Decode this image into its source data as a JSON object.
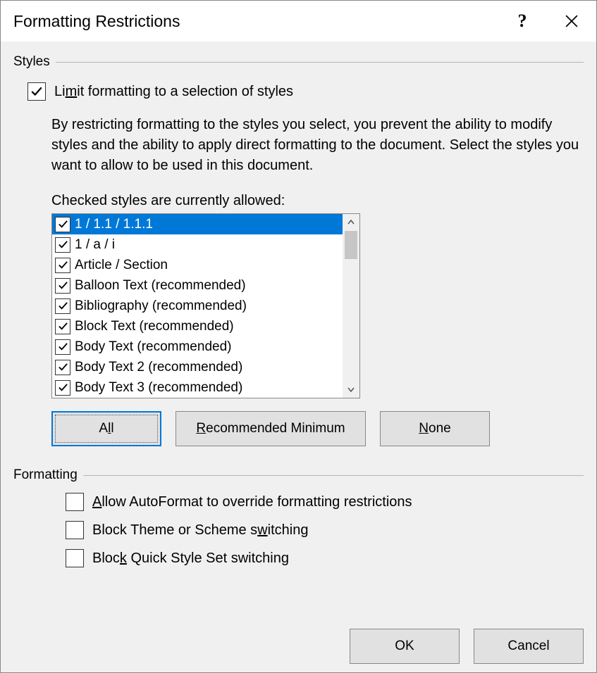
{
  "title": "Formatting Restrictions",
  "help_icon": "?",
  "sections": {
    "styles_header": "Styles",
    "formatting_header": "Formatting"
  },
  "limit_checkbox": {
    "checked": true,
    "pre": "Li",
    "ul": "m",
    "post": "it formatting to a selection of styles"
  },
  "description": "By restricting formatting to the styles you select, you prevent the ability to modify styles and the ability to apply direct formatting to the document. Select the styles you want to allow to be used in this document.",
  "checked_label": "Checked styles are currently allowed:",
  "styles": [
    {
      "label": "1 / 1.1 / 1.1.1",
      "checked": true,
      "selected": true
    },
    {
      "label": "1 / a / i",
      "checked": true,
      "selected": false
    },
    {
      "label": "Article / Section",
      "checked": true,
      "selected": false
    },
    {
      "label": "Balloon Text (recommended)",
      "checked": true,
      "selected": false
    },
    {
      "label": "Bibliography (recommended)",
      "checked": true,
      "selected": false
    },
    {
      "label": "Block Text (recommended)",
      "checked": true,
      "selected": false
    },
    {
      "label": "Body Text (recommended)",
      "checked": true,
      "selected": false
    },
    {
      "label": "Body Text 2 (recommended)",
      "checked": true,
      "selected": false
    },
    {
      "label": "Body Text 3 (recommended)",
      "checked": true,
      "selected": false
    }
  ],
  "selection_buttons": {
    "all": {
      "pre": "A",
      "ul": "l",
      "post": "l"
    },
    "rec": {
      "pre": "",
      "ul": "R",
      "post": "ecommended Minimum"
    },
    "none": {
      "pre": "",
      "ul": "N",
      "post": "one"
    }
  },
  "formatting_checks": {
    "autoformat": {
      "checked": false,
      "pre": "",
      "ul": "A",
      "post": "llow AutoFormat to override formatting restrictions"
    },
    "block_theme": {
      "checked": false,
      "pre": "Block Theme or Scheme s",
      "ul": "w",
      "post": "itching"
    },
    "block_quick": {
      "checked": false,
      "pre": "Bloc",
      "ul": "k",
      "post": " Quick Style Set switching"
    }
  },
  "footer": {
    "ok": "OK",
    "cancel": "Cancel"
  }
}
